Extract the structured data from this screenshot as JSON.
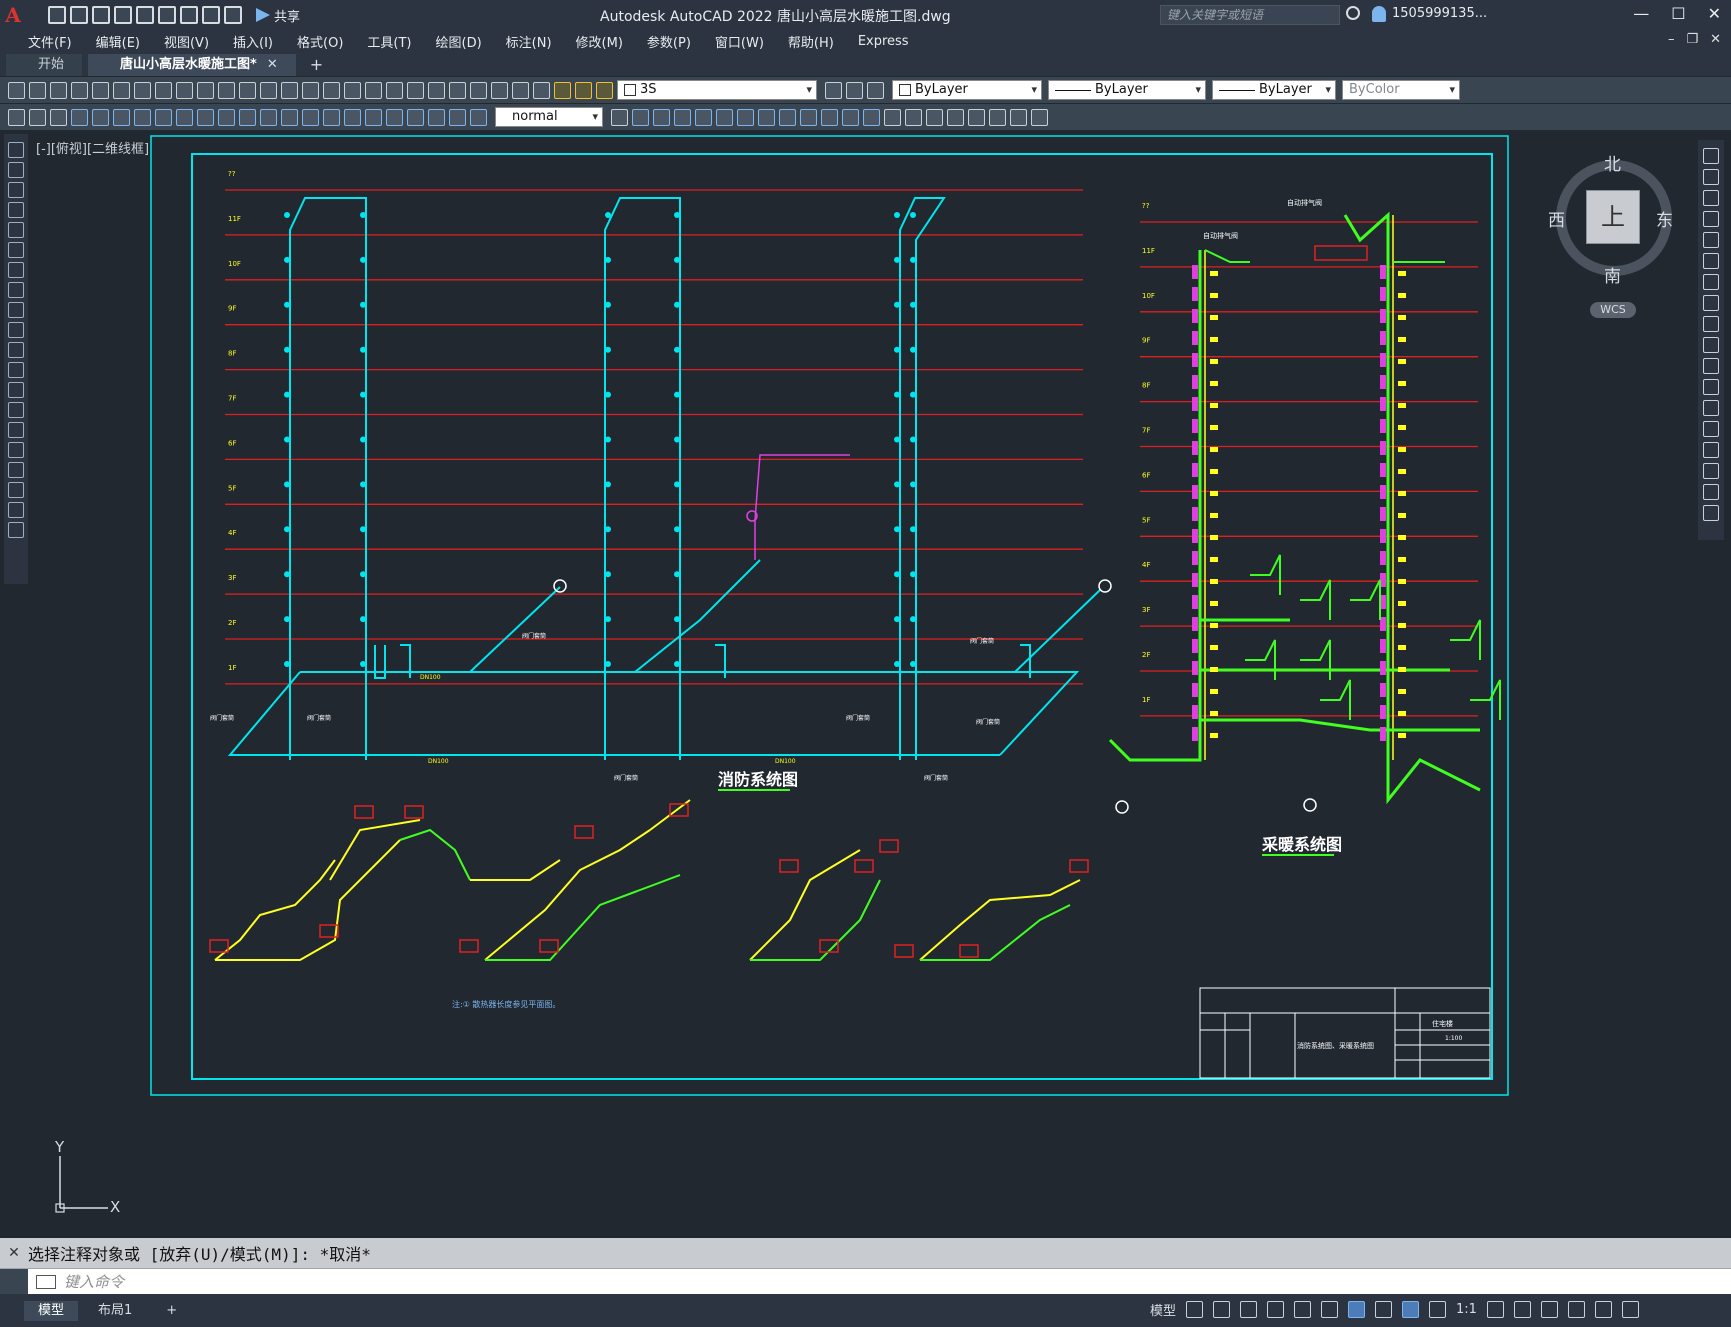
{
  "titlebar": {
    "app_title": "Autodesk AutoCAD 2022    唐山小高层水暖施工图.dwg",
    "share_label": "共享",
    "search_placeholder": "键入关键字或短语",
    "user_name": "1505999135...",
    "logo": "A"
  },
  "menu": {
    "items": [
      "文件(F)",
      "编辑(E)",
      "视图(V)",
      "插入(I)",
      "格式(O)",
      "工具(T)",
      "绘图(D)",
      "标注(N)",
      "修改(M)",
      "参数(P)",
      "窗口(W)",
      "帮助(H)",
      "Express"
    ]
  },
  "tabs": {
    "start_label": "开始",
    "active_label": "唐山小高层水暖施工图*",
    "close_glyph": "✕",
    "new_glyph": "+"
  },
  "toolbar1": {
    "layer_value": "3S",
    "color_value": "ByLayer",
    "linetype_value": "ByLayer",
    "lineweight_value": "ByLayer",
    "plotstyle_value": "ByColor"
  },
  "toolbar2": {
    "textstyle_value": "normal"
  },
  "viewport": {
    "label": "[-][俯视][二维线框]"
  },
  "viewcube": {
    "north": "北",
    "south": "南",
    "east": "东",
    "west": "西",
    "face": "上",
    "wcs": "WCS"
  },
  "drawing": {
    "fire_title": "消防系统图",
    "heating_title": "采暖系统图",
    "note": "注:① 散热器长度参见平面图。",
    "fire_floors": [
      "??",
      "11F",
      "10F",
      "9F",
      "8F",
      "7F",
      "6F",
      "5F",
      "4F",
      "3F",
      "2F",
      "1F"
    ],
    "heating_floors": [
      "??",
      "11F",
      "10F",
      "9F",
      "8F",
      "7F",
      "6F",
      "5F",
      "4F",
      "3F",
      "2F",
      "1F"
    ],
    "valve_label": "阀门套筒",
    "exhaust_label": "自动排气阀",
    "pipe_label": "DN100",
    "titleblock_label": "消防系统图、采暖系统图",
    "titleblock_owner": "住宅楼",
    "titleblock_scale": "1:100"
  },
  "ucs": {
    "x": "X",
    "y": "Y"
  },
  "command": {
    "history": "选择注释对象或 [放弃(U)/模式(M)]: *取消*",
    "placeholder": "键入命令"
  },
  "status": {
    "model_tab": "模型",
    "layout_tab": "布局1",
    "model_label": "模型",
    "scale": "1:1"
  },
  "colors": {
    "background": "#212830",
    "cyan": "#00e5ee",
    "red": "#e02020",
    "green": "#40ff20",
    "yellow": "#ffff20",
    "magenta": "#e040e0"
  }
}
